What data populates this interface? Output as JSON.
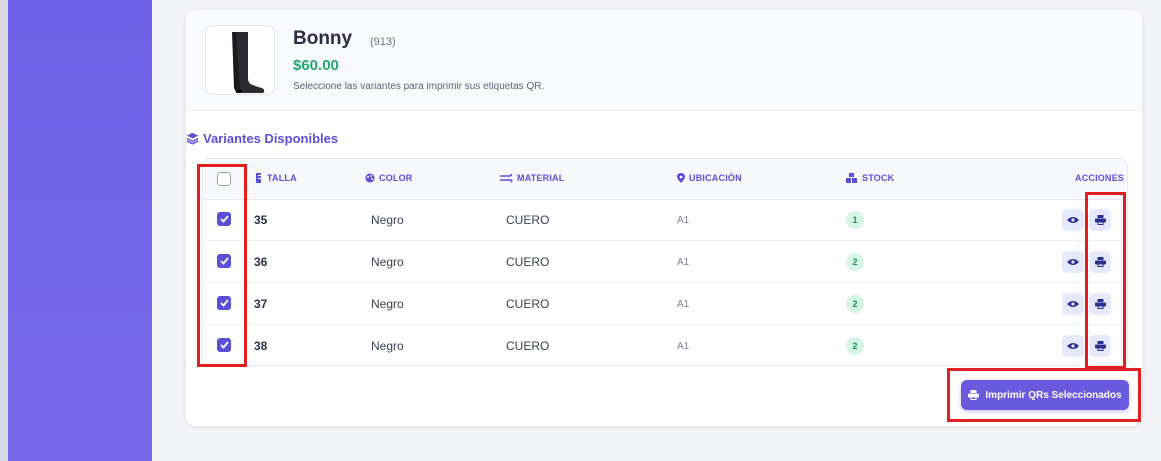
{
  "product": {
    "name": "Bonny",
    "code": "(913)",
    "price": "$60.00",
    "hint": "Seleccione las variantes para imprimir sus etiquetas QR."
  },
  "section": {
    "title": "Variantes Disponibles",
    "icon": "layers-icon"
  },
  "table": {
    "headers": {
      "talla": "TALLA",
      "color": "COLOR",
      "material": "MATERIAL",
      "ubicacion": "UBICACIÓN",
      "stock": "STOCK",
      "acciones": "ACCIONES"
    },
    "rows": [
      {
        "talla": "35",
        "color": "Negro",
        "material": "CUERO",
        "ubicacion": "A1",
        "stock": "1"
      },
      {
        "talla": "36",
        "color": "Negro",
        "material": "CUERO",
        "ubicacion": "A1",
        "stock": "2"
      },
      {
        "talla": "37",
        "color": "Negro",
        "material": "CUERO",
        "ubicacion": "A1",
        "stock": "2"
      },
      {
        "talla": "38",
        "color": "Negro",
        "material": "CUERO",
        "ubicacion": "A1",
        "stock": "2"
      }
    ]
  },
  "print_button": {
    "label": "Imprimir QRs Seleccionados",
    "icon": "printer-icon"
  },
  "colors": {
    "accent": "#6a5ae0",
    "price": "#20a86b",
    "highlight": "#e02020",
    "sidebar": "#6d60e6"
  }
}
